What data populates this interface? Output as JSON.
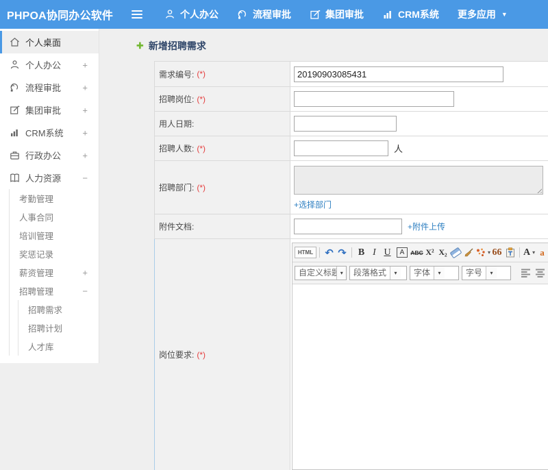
{
  "header": {
    "logo": "PHPOA协同办公软件",
    "nav": [
      {
        "label": "个人办公"
      },
      {
        "label": "流程审批"
      },
      {
        "label": "集团审批"
      },
      {
        "label": "CRM系统"
      },
      {
        "label": "更多应用"
      }
    ]
  },
  "sidebar": {
    "items": [
      {
        "label": "个人桌面",
        "level": 1,
        "active": true,
        "toggle": ""
      },
      {
        "label": "个人办公",
        "level": 1,
        "toggle": "+"
      },
      {
        "label": "流程审批",
        "level": 1,
        "toggle": "+"
      },
      {
        "label": "集团审批",
        "level": 1,
        "toggle": "+"
      },
      {
        "label": "CRM系统",
        "level": 1,
        "toggle": "+"
      },
      {
        "label": "行政办公",
        "level": 1,
        "toggle": "+"
      },
      {
        "label": "人力资源",
        "level": 1,
        "toggle": "−"
      },
      {
        "label": "考勤管理",
        "level": 2,
        "toggle": ""
      },
      {
        "label": "人事合同",
        "level": 2,
        "toggle": ""
      },
      {
        "label": "培训管理",
        "level": 2,
        "toggle": ""
      },
      {
        "label": "奖惩记录",
        "level": 2,
        "toggle": ""
      },
      {
        "label": "薪资管理",
        "level": 2,
        "toggle": "+"
      },
      {
        "label": "招聘管理",
        "level": 2,
        "toggle": "−"
      },
      {
        "label": "招聘需求",
        "level": 3,
        "toggle": ""
      },
      {
        "label": "招聘计划",
        "level": 3,
        "toggle": ""
      },
      {
        "label": "人才库",
        "level": 3,
        "toggle": ""
      }
    ]
  },
  "page": {
    "title": "新增招聘需求"
  },
  "form": {
    "rows": [
      {
        "label": "需求编号:",
        "required": "(*)",
        "value": "20190903085431"
      },
      {
        "label": "招聘岗位:",
        "required": "(*)"
      },
      {
        "label": "用人日期:"
      },
      {
        "label": "招聘人数:",
        "required": "(*)",
        "suffix": "人"
      },
      {
        "label": "招聘部门:",
        "required": "(*)",
        "link": "+选择部门"
      },
      {
        "label": "附件文档:",
        "link": "+附件上传"
      },
      {
        "label": "岗位要求:",
        "required": "(*)"
      }
    ]
  },
  "editor": {
    "toolbar": {
      "html": "HTML",
      "undo": "↶",
      "redo": "↷",
      "bold": "B",
      "italic": "I",
      "underline": "U",
      "char_border": "A",
      "strike": "ABC",
      "superscript": "X²",
      "subscript": "X₂",
      "quote": "66",
      "font_color": "A",
      "bg_color": "a",
      "caret": "▾"
    },
    "combos": [
      {
        "label": "自定义标题"
      },
      {
        "label": "段落格式"
      },
      {
        "label": "字体"
      },
      {
        "label": "字号"
      }
    ]
  },
  "colors": {
    "header_bg": "#4a99e5",
    "link": "#2e7fc1",
    "required": "#e53e3e",
    "title": "#32486b",
    "plus_green": "#72b633",
    "active_border": "#4a99e5"
  }
}
